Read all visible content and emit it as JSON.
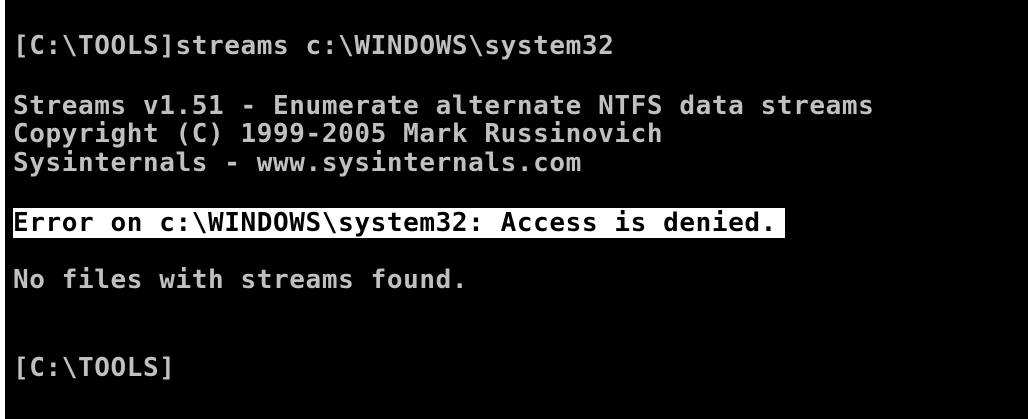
{
  "console": {
    "lines": [
      "[C:\\TOOLS]streams c:\\WINDOWS\\system32",
      "Streams v1.51 - Enumerate alternate NTFS data streams",
      "Copyright (C) 1999-2005 Mark Russinovich",
      "Sysinternals - www.sysinternals.com",
      "Error on c:\\WINDOWS\\system32: Access is denied.",
      "No files with streams found.",
      "[C:\\TOOLS]"
    ]
  },
  "colors": {
    "background": "#000000",
    "text": "#c0c0c0",
    "highlight_background": "#ffffff",
    "highlight_text": "#000000",
    "frame": "#ffffff"
  }
}
